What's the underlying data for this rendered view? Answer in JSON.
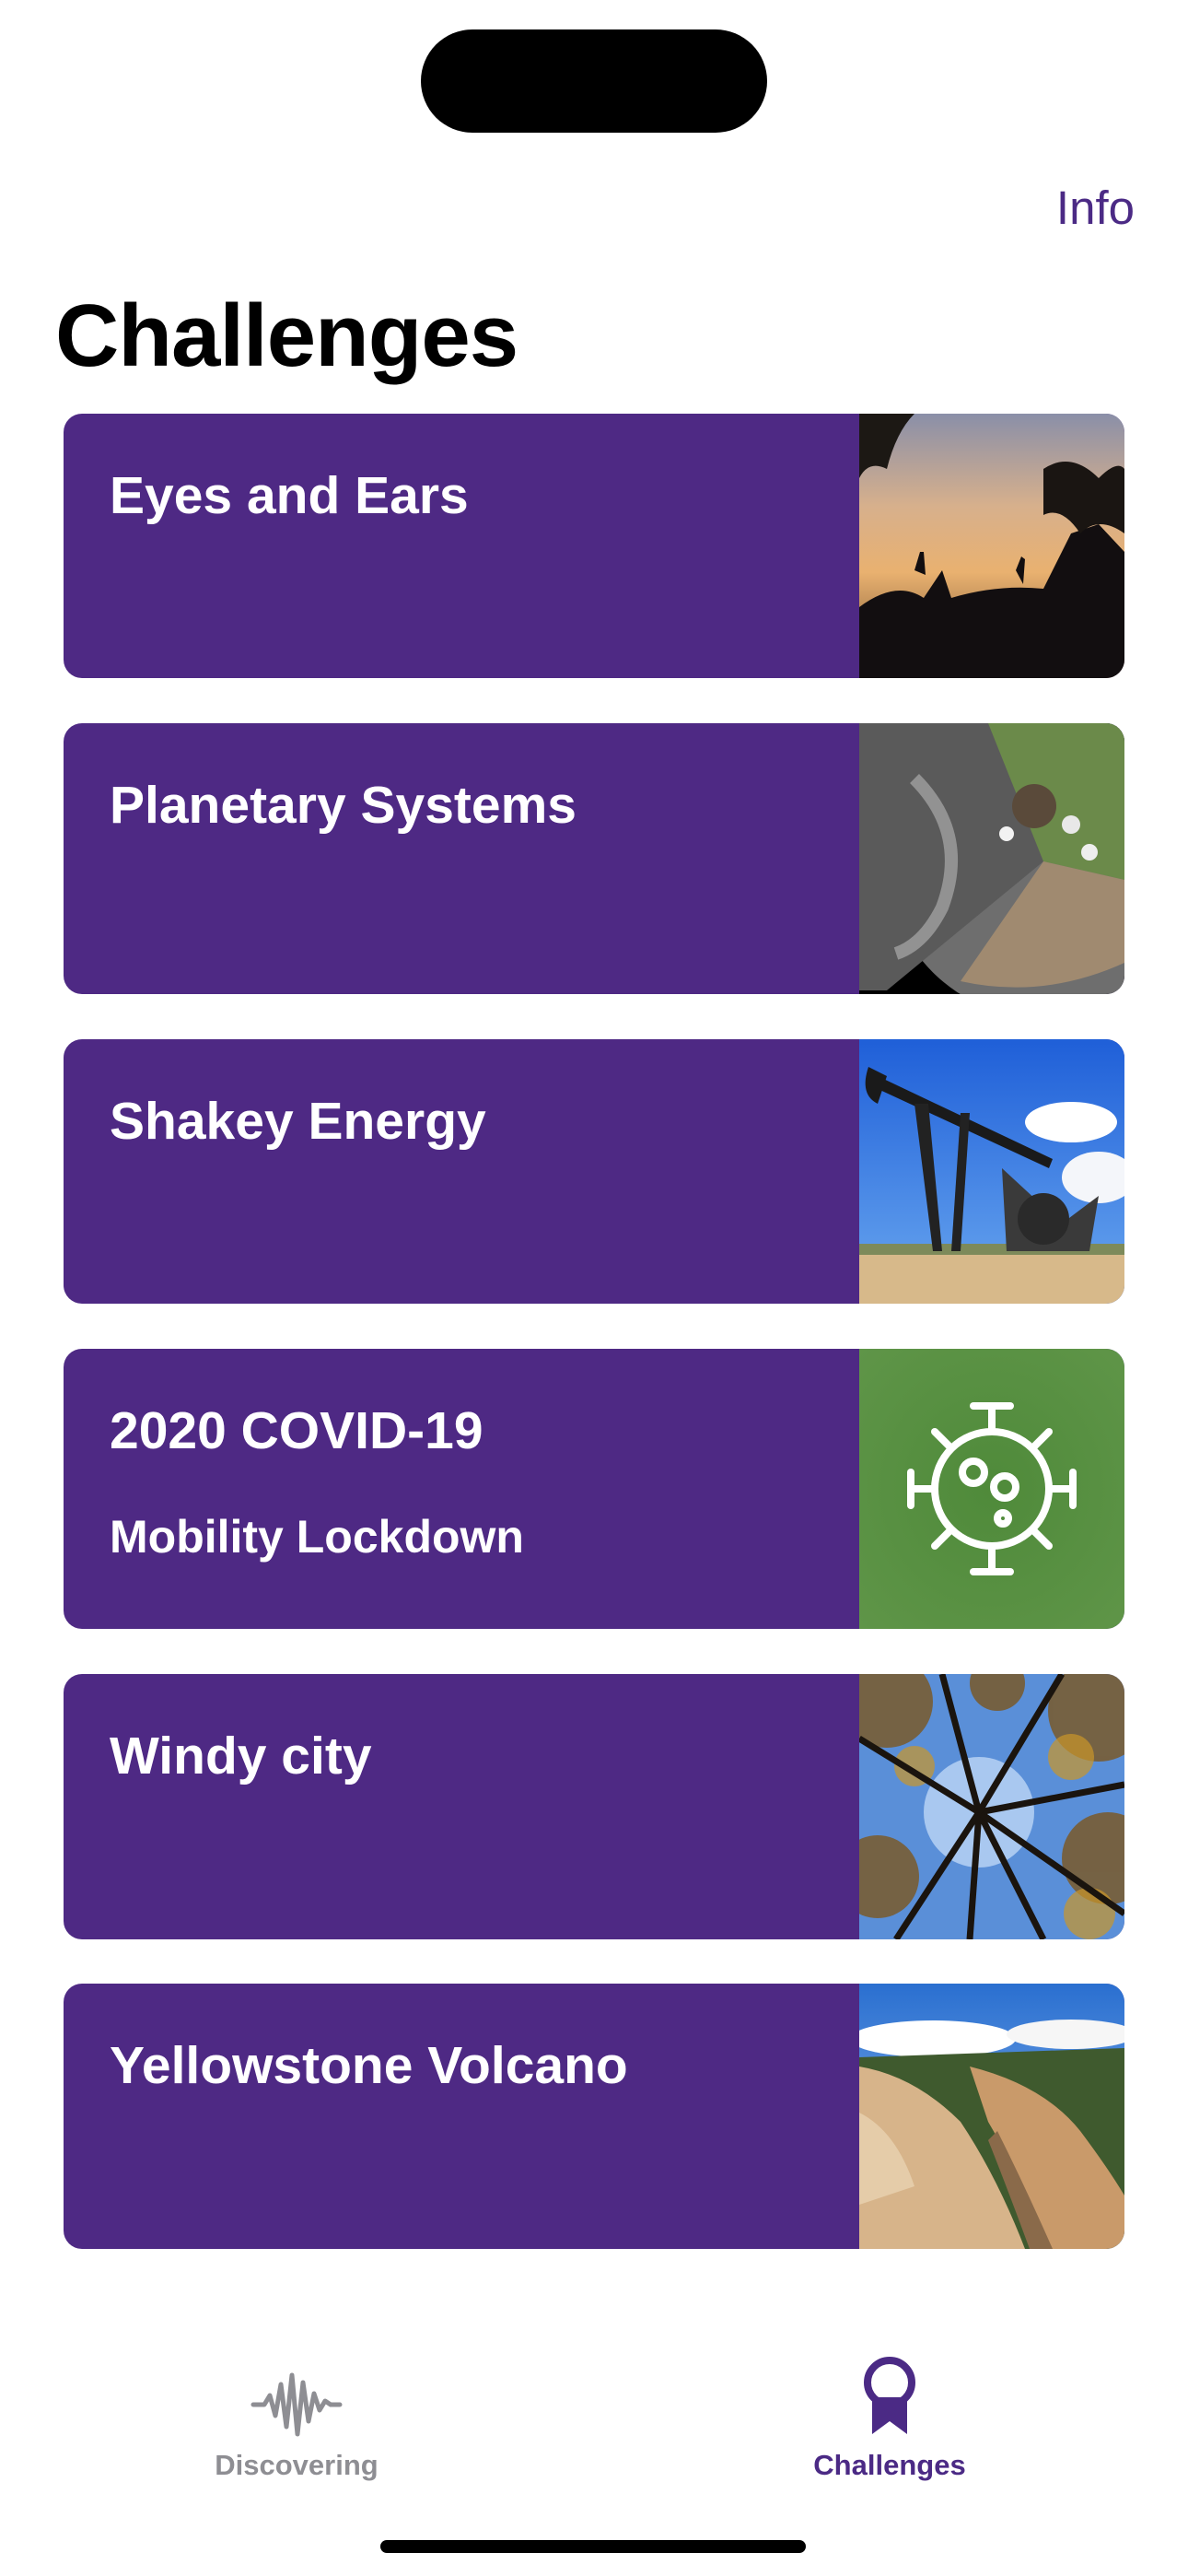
{
  "header": {
    "info_label": "Info",
    "title": "Challenges"
  },
  "challenges": [
    {
      "title": "Eyes and Ears",
      "subtitle": "",
      "image_icon": "savanna-sunset-image"
    },
    {
      "title": "Planetary Systems",
      "subtitle": "",
      "image_icon": "planets-collage-image"
    },
    {
      "title": "Shakey Energy",
      "subtitle": "",
      "image_icon": "oil-pumpjack-image"
    },
    {
      "title": "2020 COVID-19",
      "subtitle": "Mobility Lockdown",
      "image_icon": "virus-icon"
    },
    {
      "title": "Windy city",
      "subtitle": "",
      "image_icon": "forest-canopy-image"
    },
    {
      "title": "Yellowstone Volcano",
      "subtitle": "",
      "image_icon": "canyon-image"
    }
  ],
  "tabbar": {
    "tabs": [
      {
        "label": "Discovering",
        "icon": "waveform-icon",
        "active": false
      },
      {
        "label": "Challenges",
        "icon": "award-ribbon-icon",
        "active": true
      }
    ]
  },
  "colors": {
    "accent": "#4b2a85",
    "card_background": "#4e2984",
    "inactive_tab": "#8e8e93"
  }
}
